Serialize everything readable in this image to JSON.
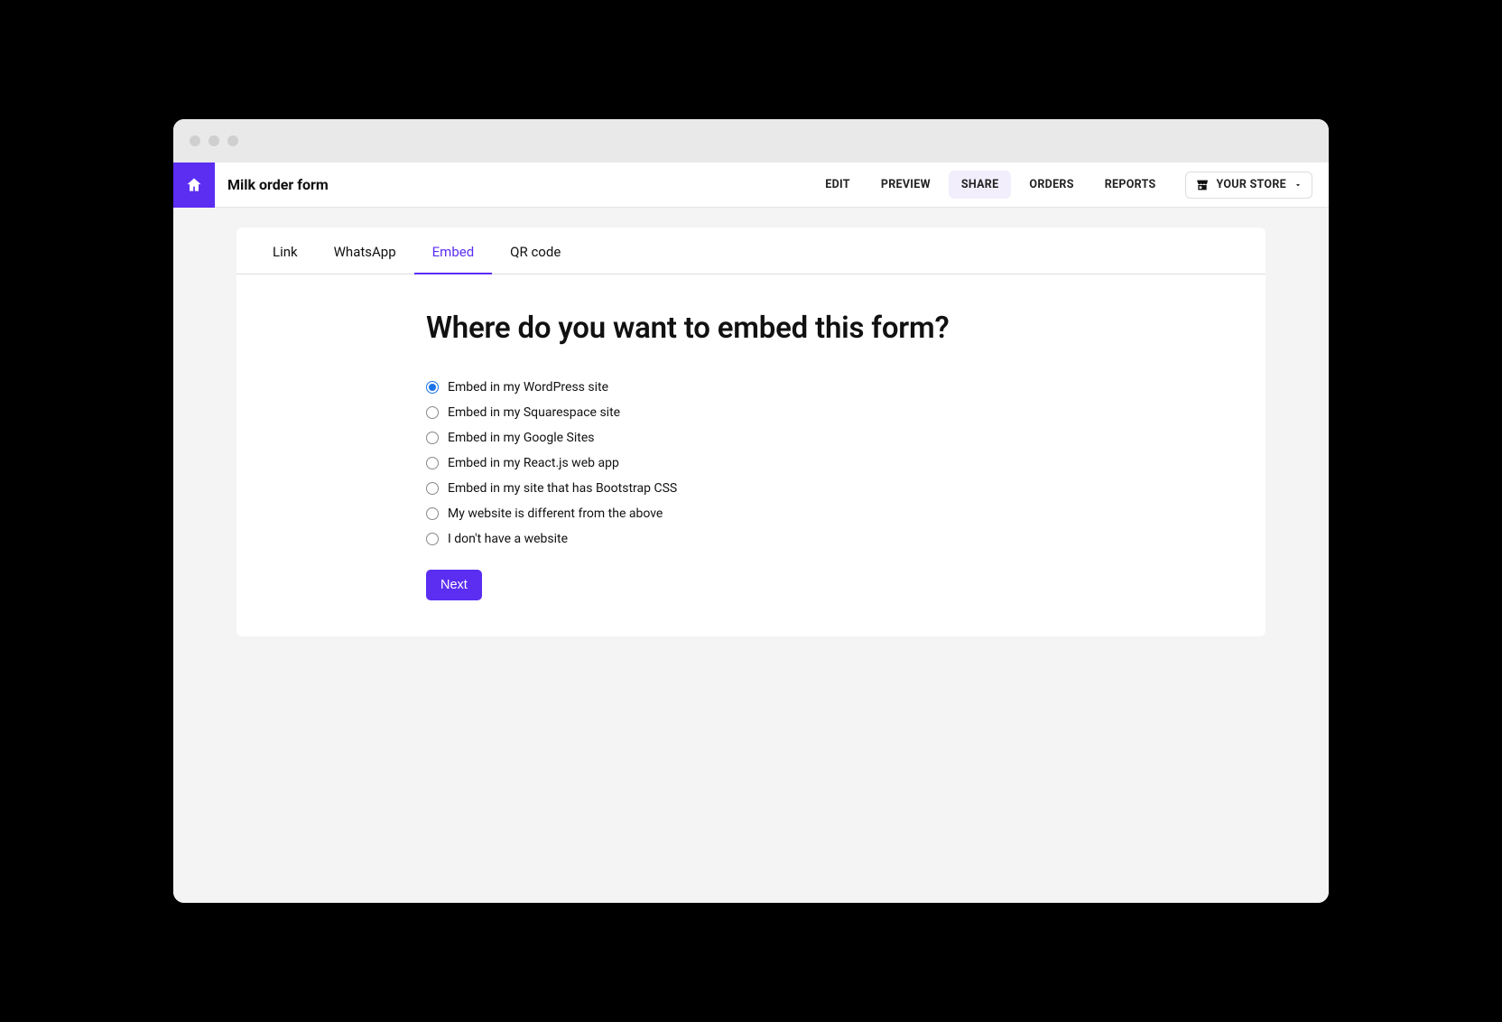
{
  "header": {
    "title": "Milk order form",
    "nav": [
      "EDIT",
      "PREVIEW",
      "SHARE",
      "ORDERS",
      "REPORTS"
    ],
    "nav_active_index": 2,
    "store_label": "YOUR STORE"
  },
  "tabs": {
    "items": [
      "Link",
      "WhatsApp",
      "Embed",
      "QR code"
    ],
    "active_index": 2
  },
  "embed": {
    "question": "Where do you want to embed this form?",
    "options": [
      "Embed in my WordPress site",
      "Embed in my Squarespace site",
      "Embed in my Google Sites",
      "Embed in my React.js web app",
      "Embed in my site that has Bootstrap CSS",
      "My website is different from the above",
      "I don't have a website"
    ],
    "selected_index": 0,
    "next_label": "Next"
  },
  "colors": {
    "accent": "#5b2ef2",
    "radio_selected": "#1a73e8"
  }
}
